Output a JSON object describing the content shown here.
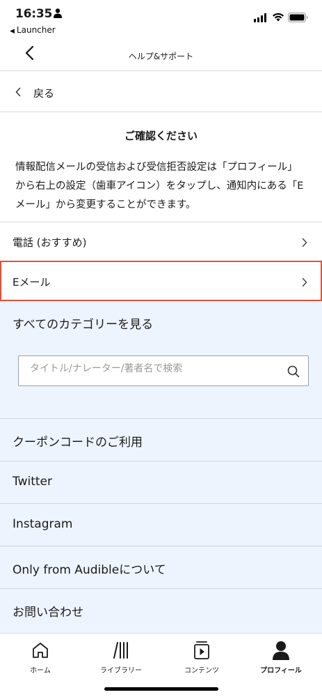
{
  "status_bar": {
    "time": "16:35",
    "back_app": "Launcher"
  },
  "nav": {
    "title": "ヘルプ&サポート"
  },
  "back_row": {
    "label": "戻る"
  },
  "notice": {
    "title": "ご確認ください",
    "body": "情報配信メールの受信および受信拒否設定は「プロフィール」から右上の設定（歯車アイコン）をタップし、通知内にある「Eメール」から変更することができます。"
  },
  "contact": {
    "phone_label": "電話 (おすすめ)",
    "email_label": "Eメール"
  },
  "browse": {
    "all_categories": "すべてのカテゴリーを見る",
    "search_placeholder": "タイトル/ナレーター/著者名で検索"
  },
  "links": [
    {
      "label": "クーポンコードのご利用"
    },
    {
      "label": "Twitter"
    },
    {
      "label": "Instagram"
    },
    {
      "label": "Only from Audibleについて"
    },
    {
      "label": "お問い合わせ"
    }
  ],
  "tabs": [
    {
      "label": "ホーム",
      "icon": "home-icon"
    },
    {
      "label": "ライブラリー",
      "icon": "library-icon"
    },
    {
      "label": "コンテンツ",
      "icon": "content-icon"
    },
    {
      "label": "プロフィール",
      "icon": "profile-icon",
      "active": true
    }
  ],
  "colors": {
    "highlight_border": "#e2503a",
    "section_background": "#eef4fd"
  }
}
